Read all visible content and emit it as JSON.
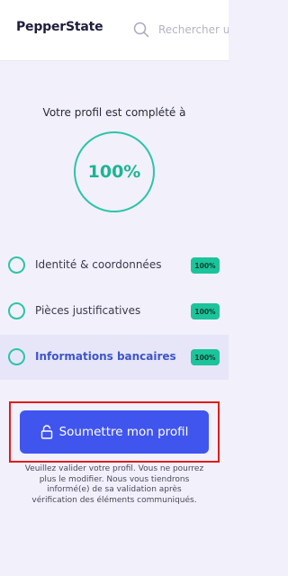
{
  "header": {
    "logo_text": "PepperState",
    "search_placeholder": "Rechercher u"
  },
  "profile": {
    "headline": "Votre profil est complété à",
    "completion": "100%",
    "completion_value": 1.0
  },
  "steps": [
    {
      "label": "Identité & coordonnées",
      "badge": "100%",
      "active": false
    },
    {
      "label": "Pièces justificatives",
      "badge": "100%",
      "active": false
    },
    {
      "label": "Informations bancaires",
      "badge": "100%",
      "active": true
    }
  ],
  "submit": {
    "label": "Soumettre mon profil",
    "helper": "Veuillez valider votre profil. Vous ne pourrez plus le modifier. Nous vous tiendrons informé(e) de sa validation après vérification des éléments communiqués."
  },
  "colors": {
    "accent": "#4055ee",
    "success": "#1bc49a",
    "highlight": "#e21b1b"
  }
}
